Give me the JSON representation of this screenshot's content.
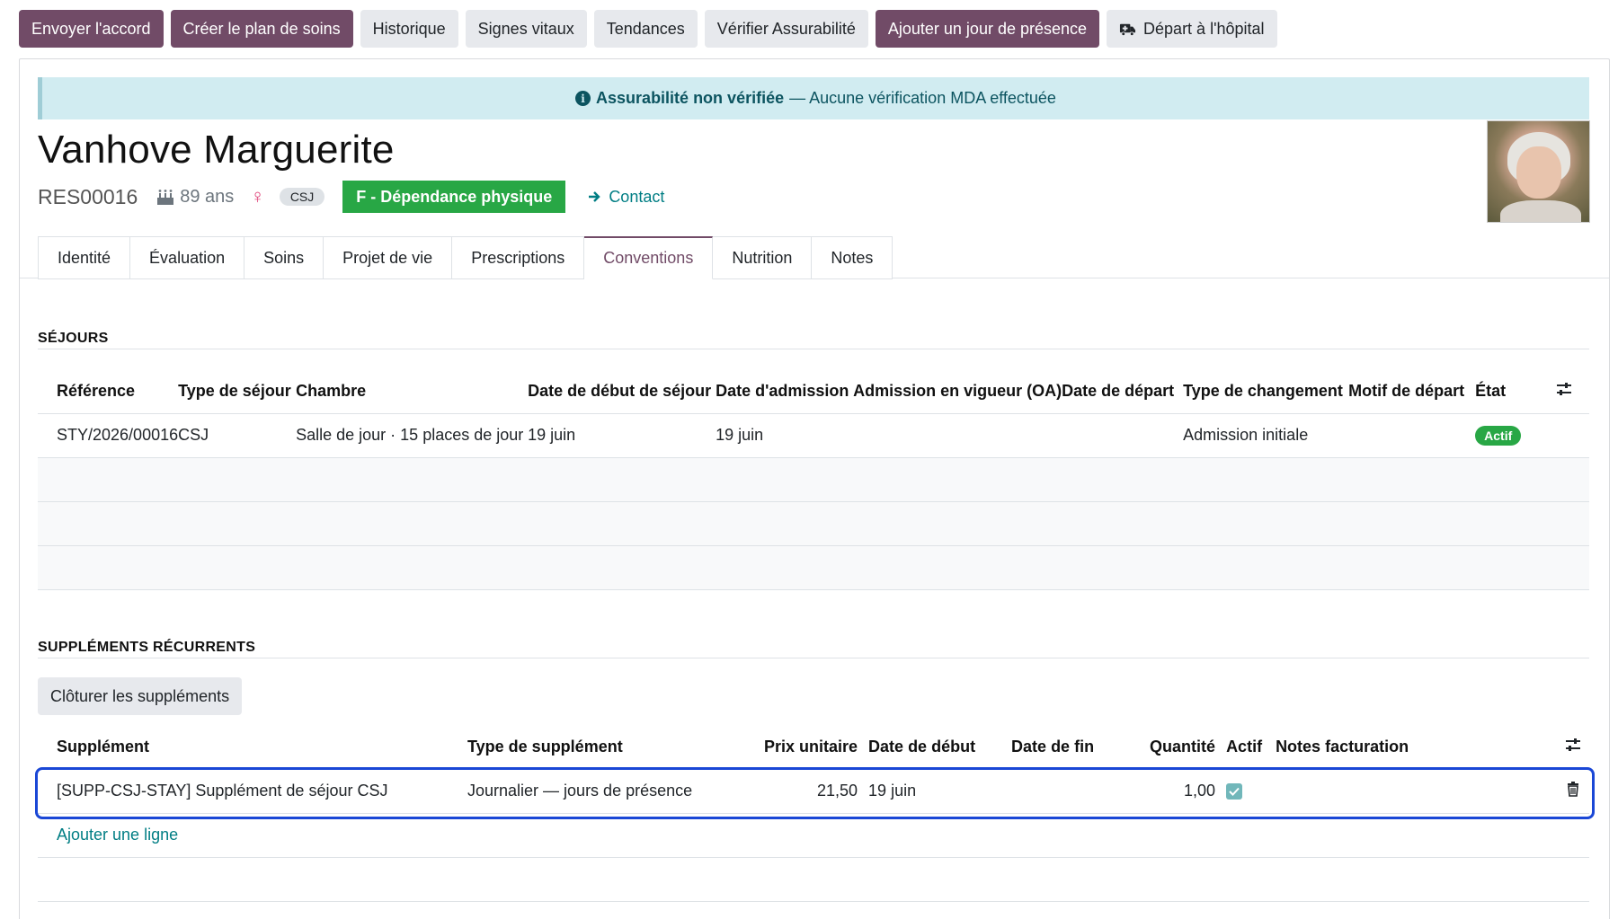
{
  "actions": [
    {
      "label": "Envoyer l'accord",
      "style": "primary"
    },
    {
      "label": "Créer le plan de soins",
      "style": "primary"
    },
    {
      "label": "Historique",
      "style": "secondary"
    },
    {
      "label": "Signes vitaux",
      "style": "secondary"
    },
    {
      "label": "Tendances",
      "style": "secondary"
    },
    {
      "label": "Vérifier Assurabilité",
      "style": "secondary"
    },
    {
      "label": "Ajouter un jour de présence",
      "style": "primary"
    },
    {
      "label": "Départ à l'hôpital",
      "style": "secondary",
      "icon": "ambulance-icon"
    }
  ],
  "alert": {
    "strong": "Assurabilité non vérifiée",
    "text": " — Aucune vérification MDA effectuée"
  },
  "resident": {
    "name": "Vanhove Marguerite",
    "ref": "RES00016",
    "age": "89 ans",
    "gender_symbol": "♀",
    "tag": "CSJ",
    "dependency": "F - Dépendance physique",
    "contact_label": "Contact"
  },
  "tabs": [
    "Identité",
    "Évaluation",
    "Soins",
    "Projet de vie",
    "Prescriptions",
    "Conventions",
    "Nutrition",
    "Notes"
  ],
  "active_tab": "Conventions",
  "stays": {
    "title": "SÉJOURS",
    "columns": [
      "Référence",
      "Type de séjour",
      "Chambre",
      "Date de début de séjour",
      "Date d'admission",
      "Admission en vigueur (OA)",
      "Date de départ",
      "Type de changement",
      "Motif de départ",
      "État"
    ],
    "rows": [
      {
        "reference": "STY/2026/00016",
        "type": "CSJ",
        "room": "Salle de jour · 15 places de jour",
        "start": "19 juin",
        "admission": "19 juin",
        "oa": "",
        "departure": "",
        "change_type": "Admission initiale",
        "departure_reason": "",
        "state": "Actif"
      }
    ]
  },
  "supplements": {
    "title": "SUPPLÉMENTS RÉCURRENTS",
    "close_button": "Clôturer les suppléments",
    "columns": [
      "Supplément",
      "Type de supplément",
      "Prix unitaire",
      "Date de début",
      "Date de fin",
      "Quantité",
      "Actif",
      "Notes facturation"
    ],
    "rows": [
      {
        "supplement": "[SUPP-CSJ-STAY] Supplément de séjour CSJ",
        "type": "Journalier — jours de présence",
        "unit_price": "21,50",
        "start": "19 juin",
        "end": "",
        "quantity": "1,00",
        "active": true,
        "notes": ""
      }
    ],
    "add_line": "Ajouter une ligne"
  },
  "colors": {
    "primary": "#714b67",
    "secondary": "#e7e9ed",
    "success": "#28a745",
    "link": "#017e84",
    "alert_bg": "#d1ecf1",
    "selection": "#1a47d6"
  }
}
